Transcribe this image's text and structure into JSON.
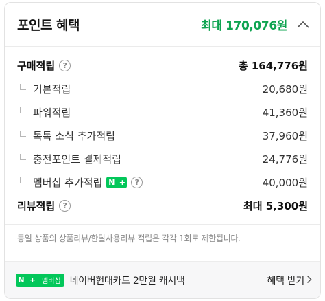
{
  "header": {
    "title": "포인트 혜택",
    "max_points": "최대 170,076원",
    "collapse_icon": "chevron-up-icon"
  },
  "purchase": {
    "label": "구매적립",
    "value": "총 164,776원",
    "items": [
      {
        "label": "기본적립",
        "value": "20,680원"
      },
      {
        "label": "파워적립",
        "value": "41,360원"
      },
      {
        "label": "톡톡 소식 추가적립",
        "value": "37,960원"
      },
      {
        "label": "충전포인트 결제적립",
        "value": "24,776원"
      },
      {
        "label": "멤버십 추가적립",
        "value": "40,000원"
      }
    ]
  },
  "review": {
    "label": "리뷰적립",
    "value": "최대 5,300원"
  },
  "icons": {
    "help": "?",
    "n": "N",
    "plus": "+"
  },
  "notice": "동일 상품의 상품리뷰/한달사용리뷰 적립은 각각 1회로 제한됩니다.",
  "promo": {
    "badge_n": "N",
    "badge_plus": "+",
    "badge_membership": "멤버십",
    "text": "네이버현대카드 2만원 캐시백",
    "cta": "혜택 받기"
  },
  "colors": {
    "accent_green": "#0fa451",
    "naver_green": "#03c75a"
  }
}
